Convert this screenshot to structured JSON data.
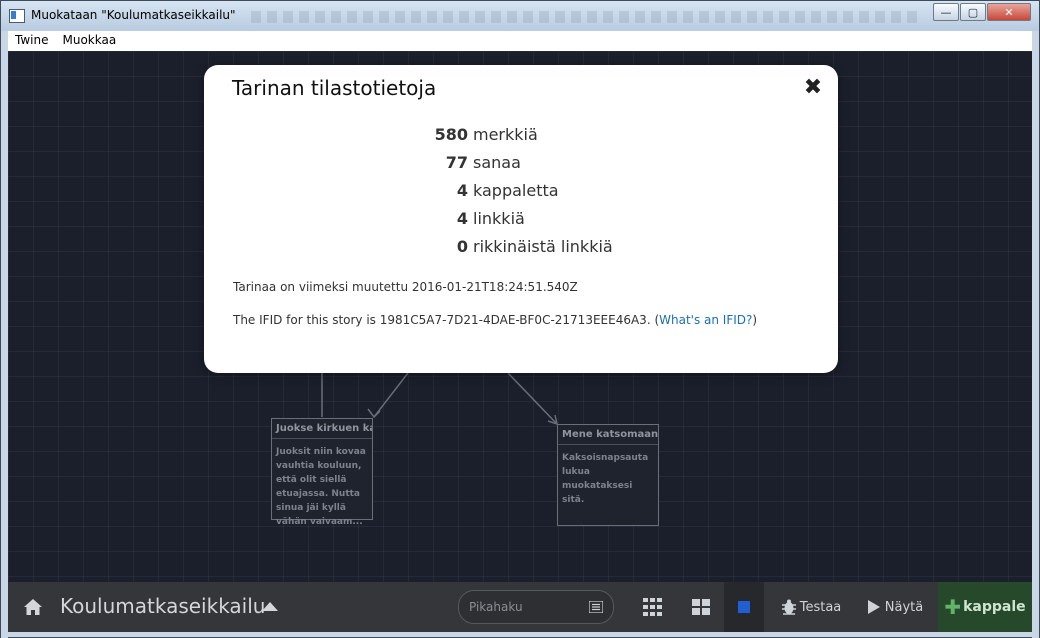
{
  "window": {
    "title": "Muokataan \"Koulumatkaseikkailu\"",
    "buttons": {
      "minimize": "—",
      "maximize": "▢",
      "close": "✕"
    }
  },
  "menu": {
    "items": [
      "Twine",
      "Muokkaa"
    ]
  },
  "passages": [
    {
      "title": "Juokse kirkuen karkuun",
      "body": "Juoksit niin kovaa vauhtia kouluun, että olit siellä etuajassa. Nutta sinua jäi kyllä vähän vaivaam..."
    },
    {
      "title": "Mene katsomaan ufoa",
      "body": "Kaksoisnapsauta lukua muokataksesi sitä."
    }
  ],
  "dialog": {
    "title": "Tarinan tilastotietoja",
    "stats": [
      {
        "value": "580",
        "label": "merkkiä"
      },
      {
        "value": "77",
        "label": "sanaa"
      },
      {
        "value": "4",
        "label": "kappaletta"
      },
      {
        "value": "4",
        "label": "linkkiä"
      },
      {
        "value": "0",
        "label": "rikkinäistä linkkiä"
      }
    ],
    "modified": "Tarinaa on viimeksi muutettu 2016-01-21T18:24:51.540Z",
    "ifid_prefix": "The IFID for this story is 1981C5A7-7D21-4DAE-BF0C-21713EEE46A3. (",
    "ifid_link": "What's an IFID?",
    "ifid_suffix": ")"
  },
  "toolbar": {
    "story_name": "Koulumatkaseikkailu",
    "search_placeholder": "Pikahaku",
    "test_label": "Testaa",
    "play_label": "Näytä",
    "add_label": "kappale"
  },
  "colors": {
    "add_button": "#27492b",
    "link": "#1a6eb5",
    "canvas": "#1b1f2b"
  }
}
